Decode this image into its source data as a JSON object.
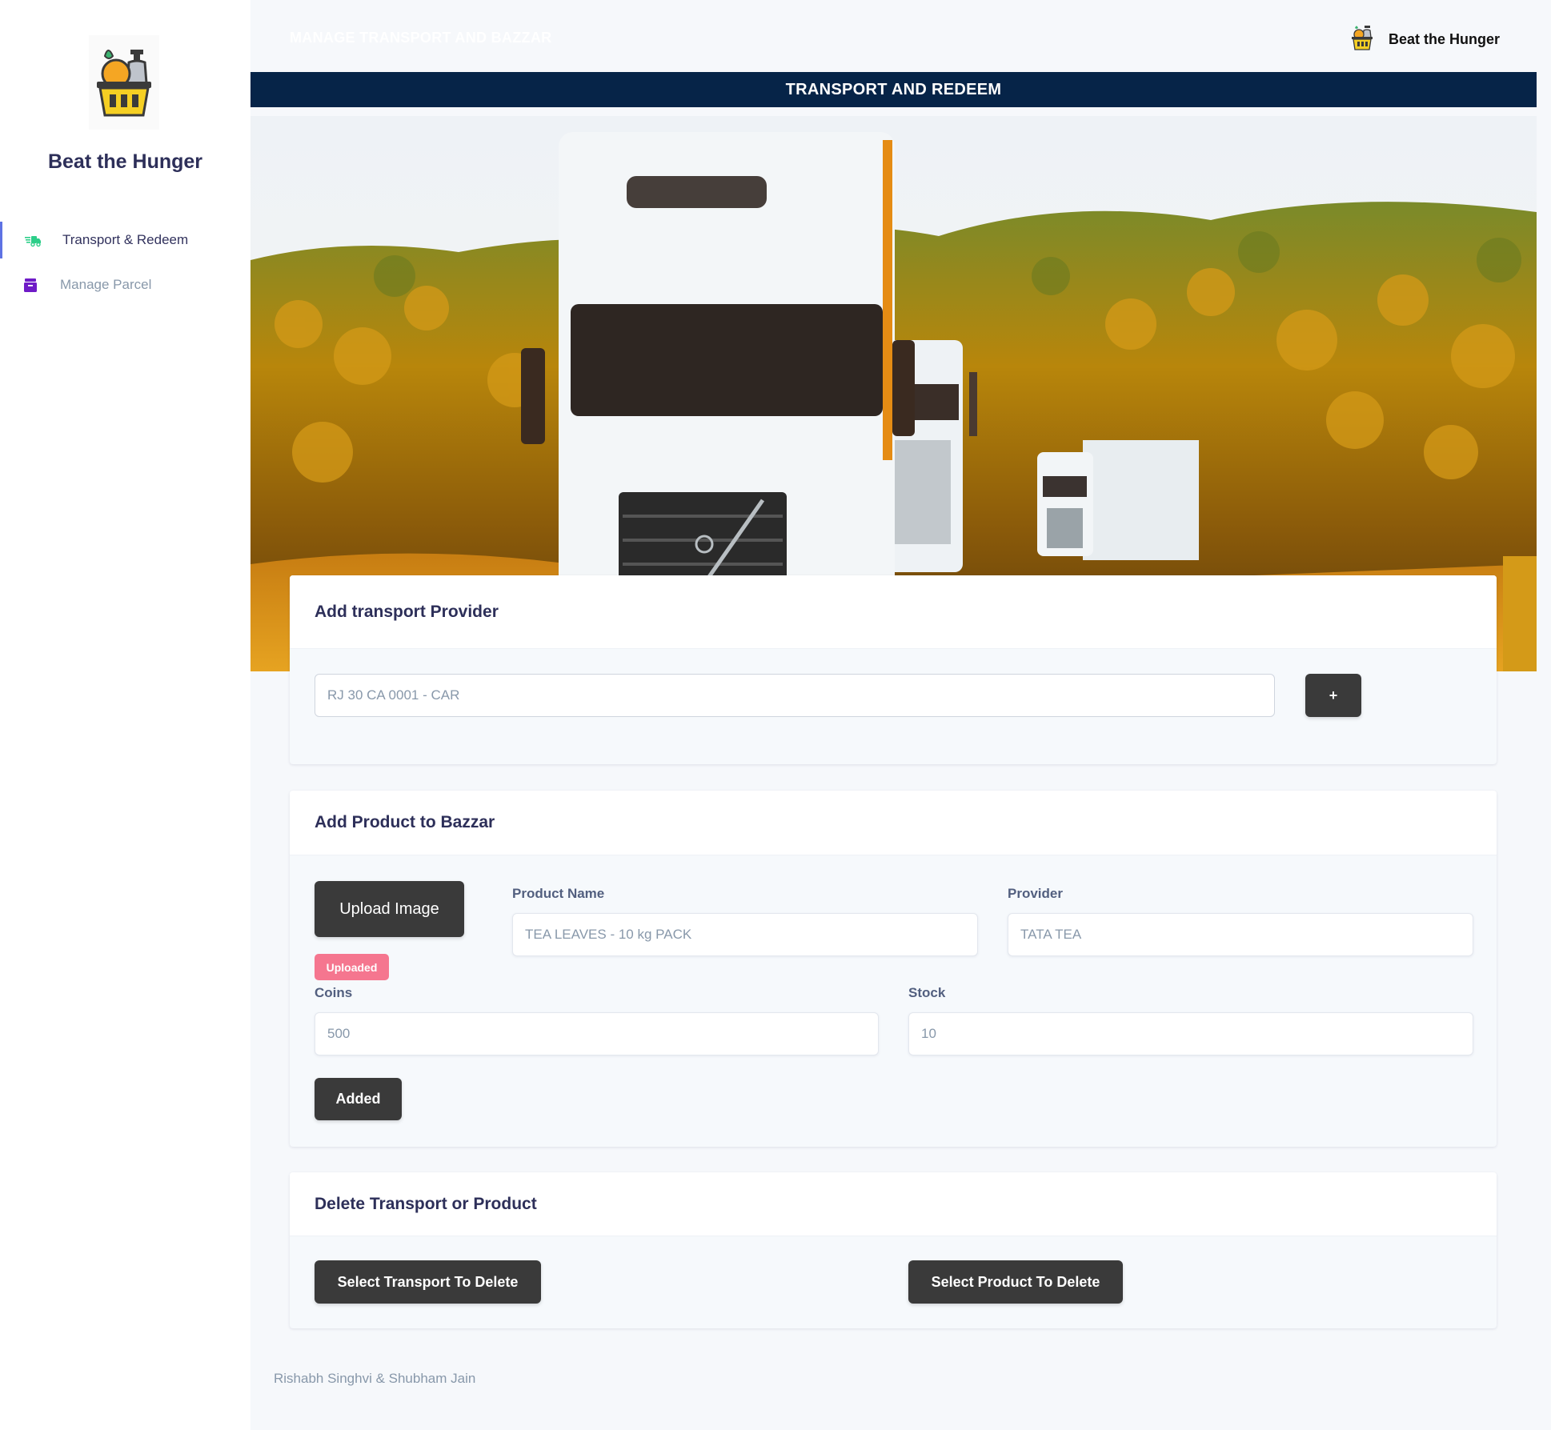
{
  "sidebar": {
    "brand_title": "Beat the Hunger",
    "items": [
      {
        "label": "Transport & Redeem",
        "icon": "delivery-truck-icon",
        "active": true
      },
      {
        "label": "Manage Parcel",
        "icon": "parcel-box-icon",
        "active": false
      }
    ]
  },
  "topbar": {
    "title": "MANAGE TRANSPORT AND BAZZAR",
    "user_name": "Beat the Hunger"
  },
  "banner": {
    "title": "TRANSPORT AND REDEEM"
  },
  "transport_card": {
    "title": "Add transport Provider",
    "input_value": "RJ 30 CA 0001 - CAR",
    "add_button_label": "+"
  },
  "product_card": {
    "title": "Add Product to Bazzar",
    "upload_button_label": "Upload Image",
    "upload_status": "Uploaded",
    "product_name_label": "Product Name",
    "product_name_value": "TEA LEAVES - 10 kg PACK",
    "provider_label": "Provider",
    "provider_value": "TATA TEA",
    "coins_label": "Coins",
    "coins_value": "500",
    "stock_label": "Stock",
    "stock_value": "10",
    "submit_button_label": "Added"
  },
  "delete_card": {
    "title": "Delete Transport or Product",
    "delete_transport_label": "Select Transport To Delete",
    "delete_product_label": "Select Product To Delete"
  },
  "footer": {
    "credits": "Rishabh Singhvi & Shubham Jain"
  },
  "colors": {
    "banner": "#062448",
    "button": "#3a3a3a",
    "badge": "#f5768f",
    "accent": "#5e72e4"
  }
}
